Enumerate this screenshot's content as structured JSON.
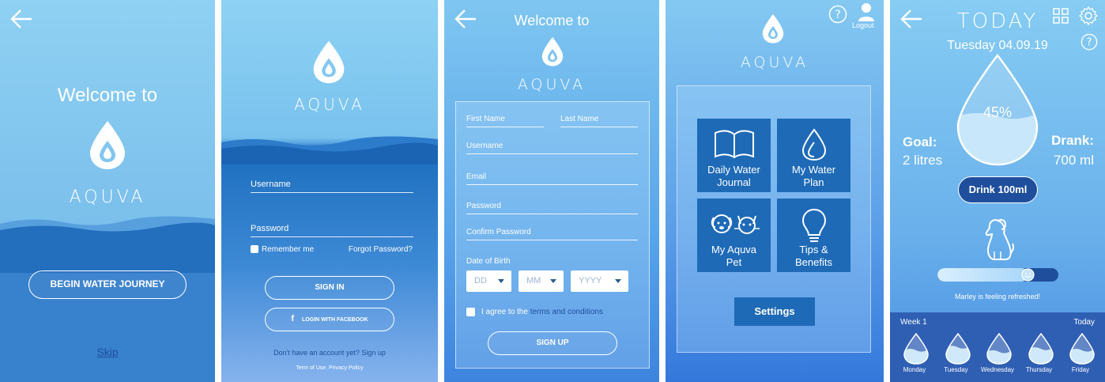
{
  "screen1": {
    "welcome": "Welcome to",
    "brand": "AQUVA",
    "begin_button": "BEGIN WATER JOURNEY",
    "skip_link": "Skip"
  },
  "screen2": {
    "brand": "AQUVA",
    "username_label": "Username",
    "password_label": "Password",
    "remember_me": "Remember me",
    "forgot_password": "Forgot Password?",
    "sign_in": "SIGN IN",
    "facebook_login": "LOGIN WITH FACEBOOK",
    "no_account": "Don't have an account yet?",
    "sign_up_link": "Sign up",
    "footer": "Term of Use. Privacy Policy"
  },
  "screen3": {
    "welcome": "Welcome to",
    "brand": "AQUVA",
    "first_name": "First Name",
    "last_name": "Last Name",
    "username": "Username",
    "email": "Email",
    "password": "Password",
    "confirm_password": "Confirm Password",
    "dob_label": "Date of Birth",
    "dd": "DD",
    "mm": "MM",
    "yyyy": "YYYY",
    "agree_prefix": "I agree to the",
    "terms_link": "terms and conditions",
    "sign_up": "SIGN UP"
  },
  "screen4": {
    "brand": "AQUVA",
    "logout": "Logout",
    "tiles": [
      {
        "label1": "Daily Water",
        "label2": "Journal"
      },
      {
        "label1": "My Water",
        "label2": "Plan"
      },
      {
        "label1": "My Aquva",
        "label2": "Pet"
      },
      {
        "label1": "Tips &",
        "label2": "Benefits"
      }
    ],
    "settings": "Settings"
  },
  "screen5": {
    "title": "TODAY",
    "date": "Tuesday 04.09.19",
    "percent": "45%",
    "fill_fraction": 0.45,
    "goal_label": "Goal:",
    "goal_value": "2 litres",
    "drank_label": "Drank:",
    "drank_value": "700 ml",
    "drink_button": "Drink 100ml",
    "pet_status": "Marley is feeling refreshed!",
    "mood_fraction": 0.75,
    "week_label": "Week 1",
    "today_label": "Today",
    "days": [
      {
        "name": "Monday",
        "fill": 0.5
      },
      {
        "name": "Tuesday",
        "fill": 0.6
      },
      {
        "name": "Wednesday",
        "fill": 0.45
      },
      {
        "name": "Thursday",
        "fill": 0.55
      },
      {
        "name": "Friday",
        "fill": 0.5
      }
    ]
  },
  "colors": {
    "tile_blue": "#1e6ab7",
    "button_dark": "#1f4f9c",
    "week_bar": "#2f5fb3"
  }
}
